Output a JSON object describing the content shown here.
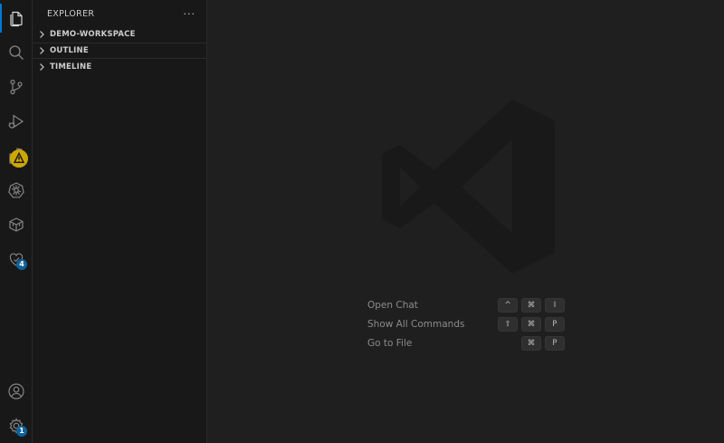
{
  "activity_bar": {
    "items": [
      {
        "name": "explorer",
        "icon": "files-icon"
      },
      {
        "name": "search",
        "icon": "search-icon"
      },
      {
        "name": "source-control",
        "icon": "source-control-icon"
      },
      {
        "name": "run-debug",
        "icon": "run-debug-icon"
      },
      {
        "name": "extensions",
        "icon": "extensions-icon"
      },
      {
        "name": "kubernetes",
        "icon": "kubernetes-icon"
      },
      {
        "name": "remote-explorer",
        "icon": "package-icon"
      },
      {
        "name": "testing",
        "icon": "testing-icon",
        "badge": "4"
      }
    ],
    "bottom": [
      {
        "name": "accounts",
        "icon": "account-icon"
      },
      {
        "name": "manage",
        "icon": "gear-icon",
        "badge": "1"
      }
    ]
  },
  "sidebar": {
    "title": "EXPLORER",
    "more": "···",
    "sections": [
      {
        "label": "DEMO-WORKSPACE"
      },
      {
        "label": "OUTLINE"
      },
      {
        "label": "TIMELINE"
      }
    ]
  },
  "editor": {
    "shortcuts": [
      {
        "label": "Open Chat",
        "keys": [
          "^",
          "⌘",
          "I"
        ]
      },
      {
        "label": "Show All Commands",
        "keys": [
          "⇧",
          "⌘",
          "P"
        ]
      },
      {
        "label": "Go to File",
        "keys": [
          "⌘",
          "P"
        ]
      }
    ]
  },
  "colors": {
    "accent": "#0078d4",
    "badge": "#0e639c",
    "warning": "#cca700"
  }
}
